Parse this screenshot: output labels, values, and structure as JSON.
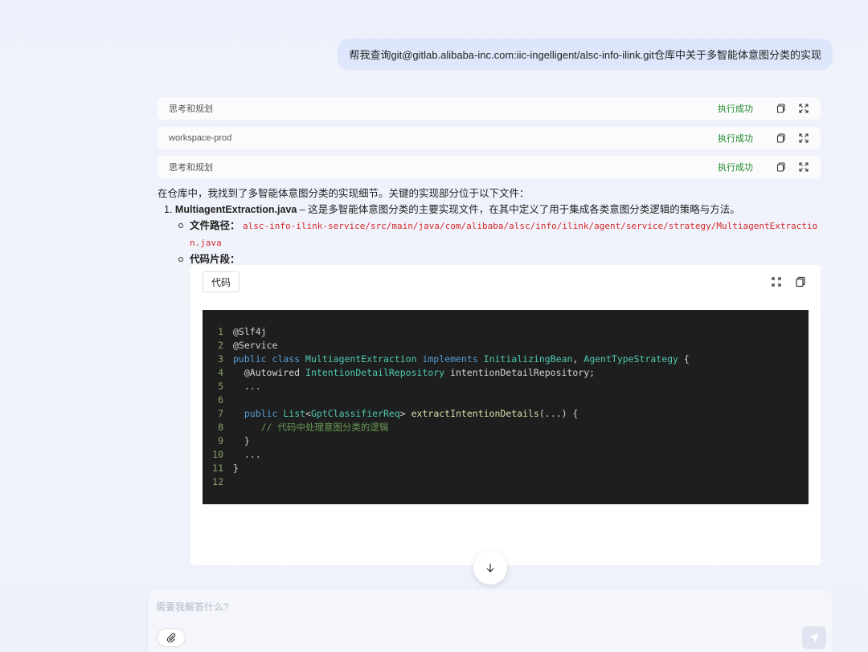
{
  "user_message": "帮我查询git@gitlab.alibaba-inc.com:iic-ingelligent/alsc-info-ilink.git仓库中关于多智能体意图分类的实现",
  "steps": [
    {
      "label": "思考和规划",
      "status": "执行成功"
    },
    {
      "label": "workspace-prod",
      "status": "执行成功"
    },
    {
      "label": "思考和规划",
      "status": "执行成功"
    }
  ],
  "answer": {
    "intro": "在仓库中，我找到了多智能体意图分类的实现细节。关键的实现部分位于以下文件：",
    "item_number": "1.",
    "item_title": "MultiagentExtraction.java",
    "item_desc": " – 这是多智能体意图分类的主要实现文件，在其中定义了用于集成各类意图分类逻辑的策略与方法。",
    "path_label": "文件路径：",
    "path_value": "alsc-info-ilink-service/src/main/java/com/alibaba/alsc/info/ilink/agent/service/strategy/MultiagentExtraction.java",
    "snippet_label": "代码片段："
  },
  "code_block": {
    "tag": "代码",
    "line_numbers": [
      "1",
      "2",
      "3",
      "4",
      "5",
      "6",
      "7",
      "8",
      "9",
      "10",
      "11",
      "12"
    ]
  },
  "input": {
    "placeholder": "需要我解答什么?"
  }
}
